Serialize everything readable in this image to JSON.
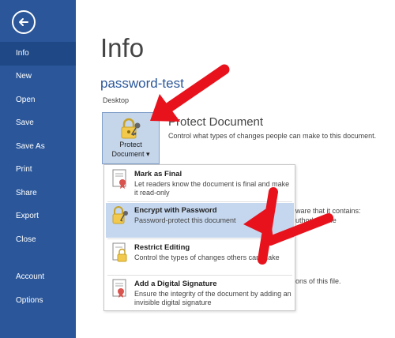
{
  "sidebar": {
    "items": [
      {
        "label": "Info"
      },
      {
        "label": "New"
      },
      {
        "label": "Open"
      },
      {
        "label": "Save"
      },
      {
        "label": "Save As"
      },
      {
        "label": "Print"
      },
      {
        "label": "Share"
      },
      {
        "label": "Export"
      },
      {
        "label": "Close"
      },
      {
        "label": "Account"
      },
      {
        "label": "Options"
      }
    ],
    "active": "Info"
  },
  "main": {
    "title": "Info",
    "doc_name": "password-test",
    "location": "Desktop",
    "protect_button": {
      "line1": "Protect",
      "line2": "Document ▾"
    },
    "protect_title": "Protect Document",
    "protect_desc": "Control what types of changes people can make to this document.",
    "background_text": {
      "inspect_fragment": "ware that it contains:",
      "author_fragment": "uthor's name",
      "versions_fragment": "ons of this file."
    }
  },
  "dropdown": {
    "items": [
      {
        "title": "Mark as Final",
        "desc": "Let readers know the document is final and make it read-only",
        "icon": "mark-final-icon"
      },
      {
        "title": "Encrypt with Password",
        "desc": "Password-protect this document",
        "icon": "lock-key-icon"
      },
      {
        "title": "Restrict Editing",
        "desc": "Control the types of changes others can make",
        "icon": "restrict-lock-icon"
      },
      {
        "title": "Add a Digital Signature",
        "desc": "Ensure the integrity of the document by adding an invisible digital signature",
        "icon": "signature-icon"
      }
    ]
  },
  "colors": {
    "accent": "#2b579a",
    "highlight": "#c5d7ee",
    "annotation_arrow": "#e8121c"
  }
}
